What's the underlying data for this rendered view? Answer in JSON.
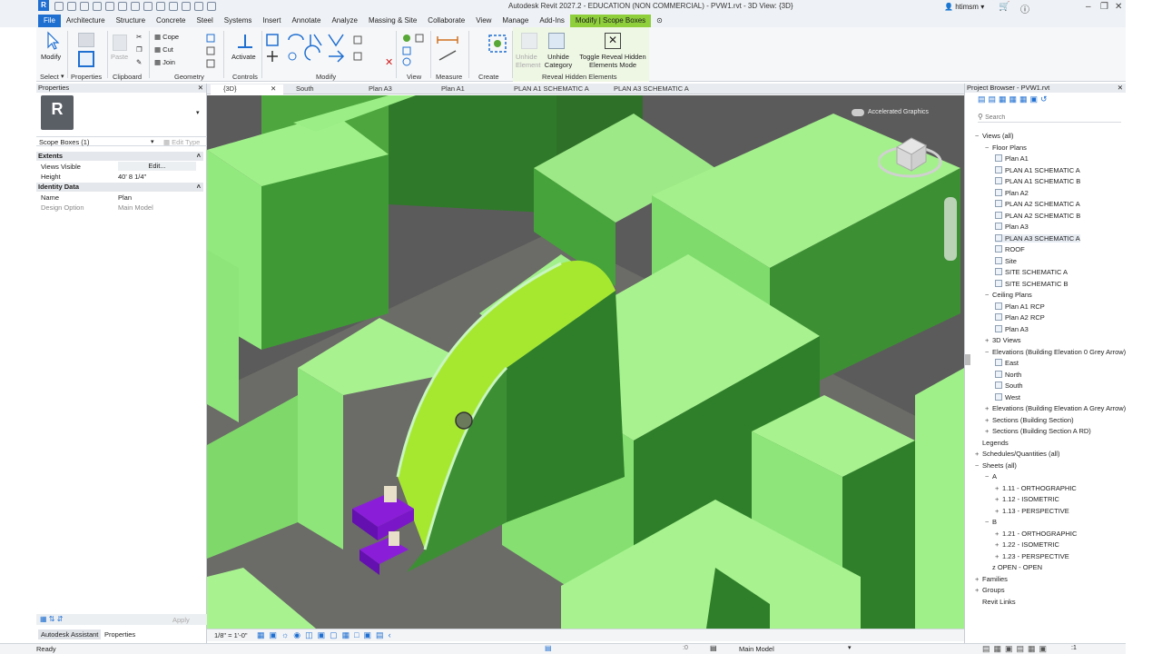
{
  "app": {
    "title": "Autodesk Revit 2027.2 - EDUCATION (NON COMMERCIAL) - PVW1.rvt - 3D View: {3D}",
    "user": "htimsm",
    "logo": "R"
  },
  "ribbon_tabs": [
    "File",
    "Architecture",
    "Structure",
    "Concrete",
    "Steel",
    "Systems",
    "Insert",
    "Annotate",
    "Analyze",
    "Massing & Site",
    "Collaborate",
    "View",
    "Manage",
    "Add-Ins",
    "Modify | Scope Boxes"
  ],
  "ribbon": {
    "modify": "Modify",
    "properties": "Properties",
    "paste": "Paste",
    "cope": "Cope",
    "cut": "Cut",
    "join": "Join",
    "activate": "Activate",
    "unhide_element": "Unhide Element",
    "unhide_category": "Unhide Category",
    "toggle_reveal": "Toggle Reveal Hidden Elements Mode",
    "panels": {
      "select": "Select",
      "properties": "Properties",
      "clipboard": "Clipboard",
      "geometry": "Geometry",
      "controls": "Controls",
      "modify": "Modify",
      "view": "View",
      "measure": "Measure",
      "create": "Create",
      "reveal": "Reveal Hidden Elements"
    }
  },
  "view_tabs": [
    {
      "label": "{3D}",
      "active": true
    },
    {
      "label": "South",
      "active": false
    },
    {
      "label": "Plan A3",
      "active": false
    },
    {
      "label": "Plan A1",
      "active": false
    },
    {
      "label": "PLAN A1 SCHEMATIC A",
      "active": false
    },
    {
      "label": "PLAN A3 SCHEMATIC A",
      "active": false
    }
  ],
  "properties": {
    "title": "Properties",
    "type_icon": "R",
    "selector": "Scope Boxes (1)",
    "edit_type": "Edit Type",
    "groups": [
      {
        "name": "Extents",
        "rows": [
          {
            "label": "Views Visible",
            "value": "Edit..."
          },
          {
            "label": "Height",
            "value": "40'  8 1/4\""
          }
        ]
      },
      {
        "name": "Identity Data",
        "rows": [
          {
            "label": "Name",
            "value": "Plan"
          },
          {
            "label": "Design Option",
            "value": "Main Model"
          }
        ]
      }
    ],
    "apply": "Apply",
    "bottom_tabs": [
      "Autodesk Assistant",
      "Properties"
    ]
  },
  "viewport": {
    "accelerated": "Accelerated Graphics",
    "scale": "1/8\" = 1'-0\"",
    "viewcube": "viewcube-icon"
  },
  "browser": {
    "title": "Project Browser - PVW1.rvt",
    "search_placeholder": "Search",
    "tree": [
      {
        "label": "Views (all)",
        "level": 0,
        "exp": "−"
      },
      {
        "label": "Floor Plans",
        "level": 1,
        "exp": "−"
      },
      {
        "label": "Plan A1",
        "level": 2,
        "box": true
      },
      {
        "label": "PLAN A1 SCHEMATIC A",
        "level": 2,
        "box": true
      },
      {
        "label": "PLAN A1 SCHEMATIC B",
        "level": 2,
        "box": true
      },
      {
        "label": "Plan A2",
        "level": 2,
        "box": true
      },
      {
        "label": "PLAN A2 SCHEMATIC A",
        "level": 2,
        "box": true
      },
      {
        "label": "PLAN A2 SCHEMATIC B",
        "level": 2,
        "box": true
      },
      {
        "label": "Plan A3",
        "level": 2,
        "box": true
      },
      {
        "label": "PLAN A3 SCHEMATIC A",
        "level": 2,
        "box": true,
        "hl": true
      },
      {
        "label": "ROOF",
        "level": 2,
        "box": true
      },
      {
        "label": "Site",
        "level": 2,
        "box": true
      },
      {
        "label": "SITE SCHEMATIC A",
        "level": 2,
        "box": true
      },
      {
        "label": "SITE SCHEMATIC B",
        "level": 2,
        "box": true
      },
      {
        "label": "Ceiling Plans",
        "level": 1,
        "exp": "−"
      },
      {
        "label": "Plan A1 RCP",
        "level": 2,
        "box": true
      },
      {
        "label": "Plan A2 RCP",
        "level": 2,
        "box": true
      },
      {
        "label": "Plan A3",
        "level": 2,
        "box": true
      },
      {
        "label": "3D Views",
        "level": 1,
        "exp": "+"
      },
      {
        "label": "Elevations (Building Elevation 0 Grey Arrow)",
        "level": 1,
        "exp": "−"
      },
      {
        "label": "East",
        "level": 2,
        "box": true
      },
      {
        "label": "North",
        "level": 2,
        "box": true
      },
      {
        "label": "South",
        "level": 2,
        "box": true
      },
      {
        "label": "West",
        "level": 2,
        "box": true
      },
      {
        "label": "Elevations (Building Elevation A Grey Arrow)",
        "level": 1,
        "exp": "+"
      },
      {
        "label": "Sections (Building Section)",
        "level": 1,
        "exp": "+"
      },
      {
        "label": "Sections (Building Section A RD)",
        "level": 1,
        "exp": "+"
      },
      {
        "label": "Legends",
        "level": 0,
        "exp": " "
      },
      {
        "label": "Schedules/Quantities (all)",
        "level": 0,
        "exp": "+"
      },
      {
        "label": "Sheets (all)",
        "level": 0,
        "exp": "−"
      },
      {
        "label": "A",
        "level": 1,
        "exp": "−"
      },
      {
        "label": "1.11 - ORTHOGRAPHIC",
        "level": 2,
        "exp": "+"
      },
      {
        "label": "1.12 - ISOMETRIC",
        "level": 2,
        "exp": "+"
      },
      {
        "label": "1.13 - PERSPECTIVE",
        "level": 2,
        "exp": "+"
      },
      {
        "label": "B",
        "level": 1,
        "exp": "−"
      },
      {
        "label": "1.21 - ORTHOGRAPHIC",
        "level": 2,
        "exp": "+"
      },
      {
        "label": "1.22 - ISOMETRIC",
        "level": 2,
        "exp": "+"
      },
      {
        "label": "1.23 - PERSPECTIVE",
        "level": 2,
        "exp": "+"
      },
      {
        "label": "z OPEN - OPEN",
        "level": 1,
        "exp": " "
      },
      {
        "label": "Families",
        "level": 0,
        "exp": "+"
      },
      {
        "label": "Groups",
        "level": 0,
        "exp": "+"
      },
      {
        "label": "Revit Links",
        "level": 0,
        "exp": " "
      }
    ]
  },
  "status": {
    "left": "Ready",
    "model": "Main Model",
    "count": ":0",
    "filter": ":1"
  },
  "colors": {
    "accent": "#1f6fd1",
    "context_tab": "#8fcf3c",
    "mass": "#8ee57a",
    "selection": "#b8f23c",
    "purple": "#7a16c8"
  }
}
